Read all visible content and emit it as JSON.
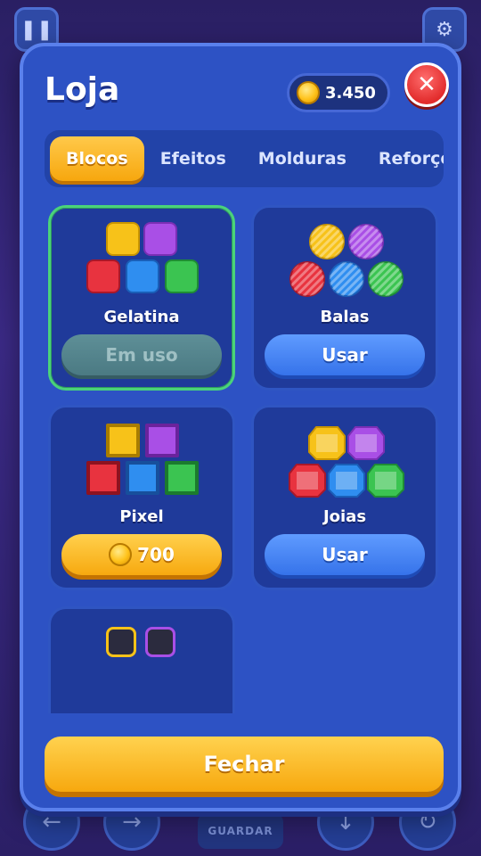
{
  "background": {
    "pause_icon": "pause-icon",
    "settings_icon": "gear-icon",
    "save_label": "GUARDAR"
  },
  "shop": {
    "title": "Loja",
    "coins": "3.450",
    "close_icon": "close-icon",
    "tabs": [
      {
        "label": "Blocos",
        "active": true
      },
      {
        "label": "Efeitos",
        "active": false
      },
      {
        "label": "Molduras",
        "active": false
      },
      {
        "label": "Reforços",
        "active": false
      }
    ],
    "items": [
      {
        "name": "Gelatina",
        "button": "Em uso",
        "state": "in-use"
      },
      {
        "name": "Balas",
        "button": "Usar",
        "state": "owned"
      },
      {
        "name": "Pixel",
        "button": "700",
        "state": "buy"
      },
      {
        "name": "Joias",
        "button": "Usar",
        "state": "owned"
      }
    ],
    "close_button": "Fechar"
  },
  "colors": {
    "yellow": "#f7c219",
    "purple": "#a94fe6",
    "red": "#e8333f",
    "blue": "#2f8ef0",
    "green": "#3bc451",
    "accent_gold": "#f7a80e",
    "panel_blue": "#2d52c4"
  }
}
